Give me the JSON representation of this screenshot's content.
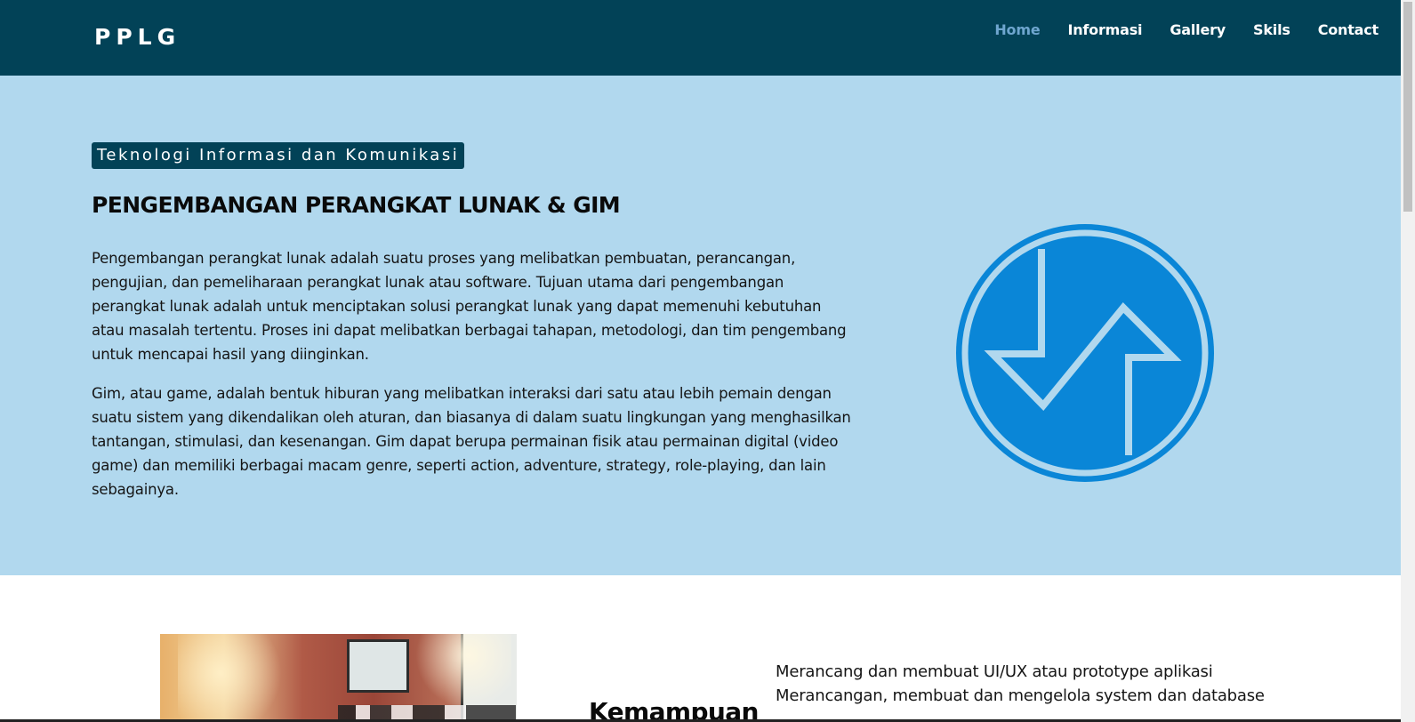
{
  "header": {
    "brand": "PPLG",
    "nav": [
      {
        "label": "Home",
        "active": true
      },
      {
        "label": "Informasi",
        "active": false
      },
      {
        "label": "Gallery",
        "active": false
      },
      {
        "label": "Skils",
        "active": false
      },
      {
        "label": "Contact",
        "active": false
      }
    ]
  },
  "hero": {
    "tag": "Teknologi Informasi dan Komunikasi",
    "title": "PENGEMBANGAN PERANGKAT LUNAK & GIM",
    "paragraph1": "Pengembangan perangkat lunak adalah suatu proses yang melibatkan pembuatan, perancangan, pengujian, dan pemeliharaan perangkat lunak atau software. Tujuan utama dari pengembangan perangkat lunak adalah untuk menciptakan solusi perangkat lunak yang dapat memenuhi kebutuhan atau masalah tertentu. Proses ini dapat melibatkan berbagai tahapan, metodologi, dan tim pengembang untuk mencapai hasil yang diinginkan.",
    "paragraph2": "Gim, atau game, adalah bentuk hiburan yang melibatkan interaksi dari satu atau lebih pemain dengan suatu sistem yang dikendalikan oleh aturan, dan biasanya di dalam suatu lingkungan yang menghasilkan tantangan, stimulasi, dan kesenangan. Gim dapat berupa permainan fisik atau permainan digital (video game) dan memiliki berbagai macam genre, seperti action, adventure, strategy, role-playing, dan lain sebagainya.",
    "logo_icon": "pplg-logo-icon"
  },
  "skills": {
    "title": "Kemampuan",
    "items": [
      "Merancang dan membuat UI/UX atau prototype aplikasi",
      "Merancangan, membuat dan mengelola system dan database"
    ]
  },
  "colors": {
    "nav_bg": "#024257",
    "hero_bg": "#b1d8ee",
    "logo_blue": "#0a86d7",
    "active_nav": "#6fa6cf"
  }
}
